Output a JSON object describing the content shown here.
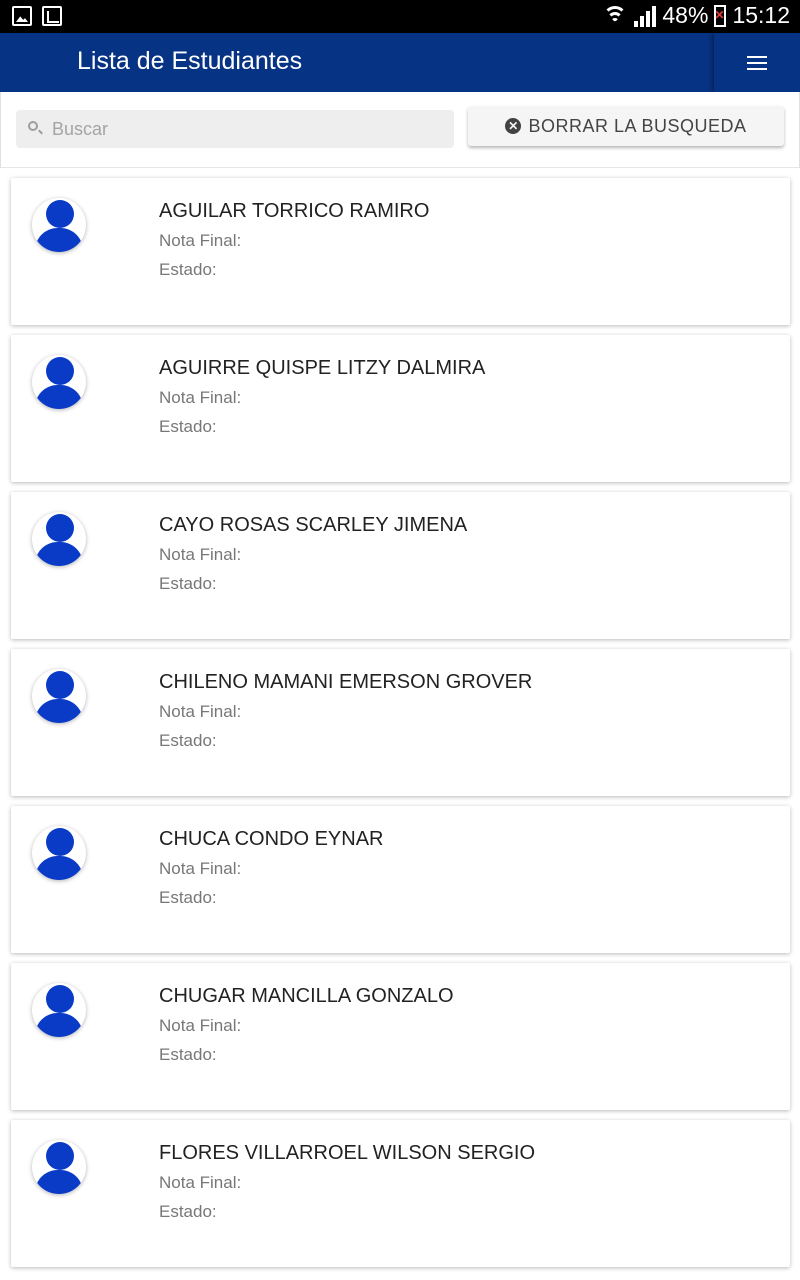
{
  "status_bar": {
    "battery": "48%",
    "time": "15:12",
    "icons": [
      "gallery-icon",
      "screencast-icon",
      "wifi-icon",
      "signal-icon",
      "battery-icon"
    ]
  },
  "app_bar": {
    "title": "Lista de Estudiantes",
    "menu_icon": "hamburger-menu-icon",
    "background_color": "#073384"
  },
  "search": {
    "placeholder": "Buscar",
    "value": "",
    "clear_label": "BORRAR LA BUSQUEDA"
  },
  "students": [
    {
      "name": "AGUILAR TORRICO RAMIRO",
      "nota_label": "Nota Final:",
      "estado_label": "Estado:"
    },
    {
      "name": "AGUIRRE QUISPE LITZY DALMIRA",
      "nota_label": "Nota Final:",
      "estado_label": "Estado:"
    },
    {
      "name": "CAYO ROSAS SCARLEY JIMENA",
      "nota_label": "Nota Final:",
      "estado_label": "Estado:"
    },
    {
      "name": "CHILENO MAMANI EMERSON GROVER",
      "nota_label": "Nota Final:",
      "estado_label": "Estado:"
    },
    {
      "name": "CHUCA CONDO EYNAR",
      "nota_label": "Nota Final:",
      "estado_label": "Estado:"
    },
    {
      "name": "CHUGAR MANCILLA GONZALO",
      "nota_label": "Nota Final:",
      "estado_label": "Estado:"
    },
    {
      "name": "FLORES VILLARROEL WILSON SERGIO",
      "nota_label": "Nota Final:",
      "estado_label": "Estado:"
    }
  ],
  "avatar_color": "#0a3bc6"
}
